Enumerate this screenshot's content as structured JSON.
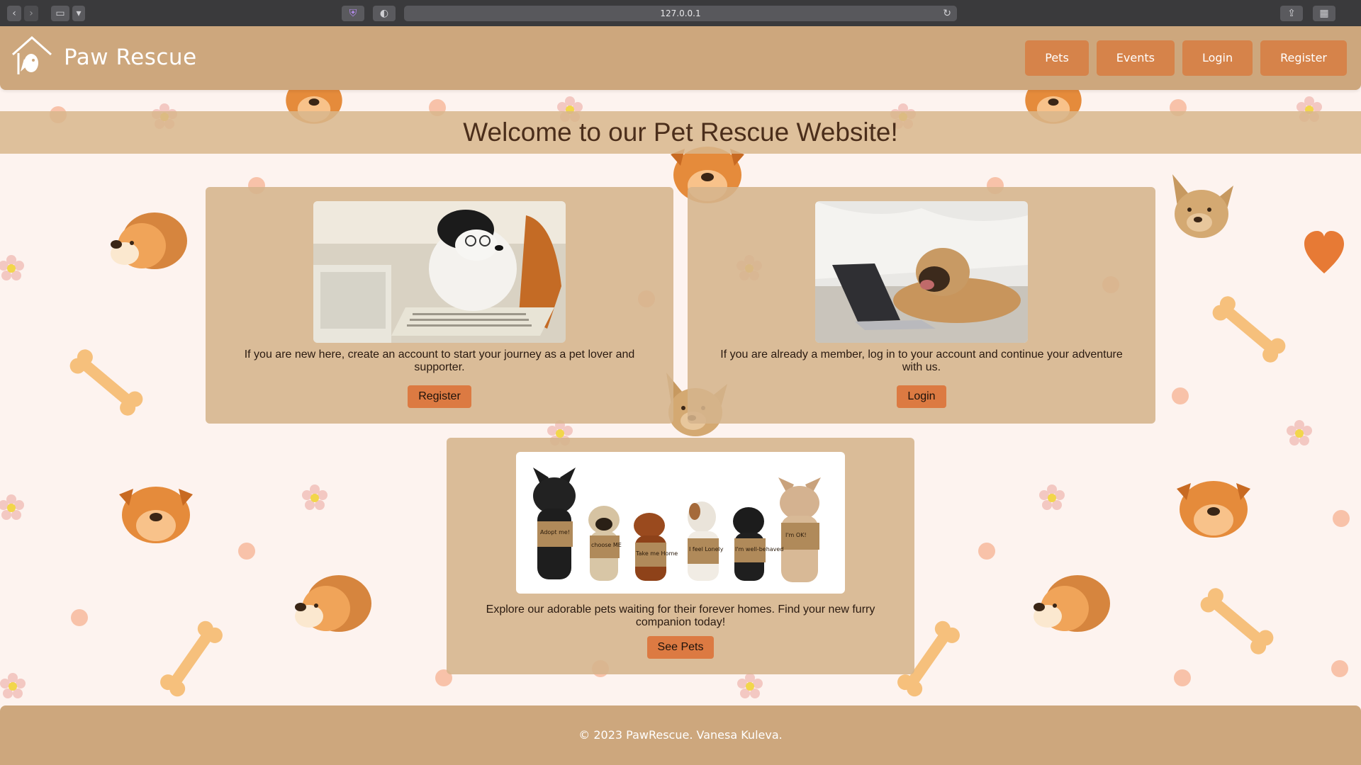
{
  "browser": {
    "url": "127.0.0.1"
  },
  "header": {
    "brand": "Paw Rescue",
    "nav": [
      "Pets",
      "Events",
      "Login",
      "Register"
    ]
  },
  "welcome": {
    "title": "Welcome to our Pet Rescue Website!"
  },
  "cards": {
    "register": {
      "text": "If you are new here, create an account to start your journey as a pet lover and supporter.",
      "button": "Register"
    },
    "login": {
      "text": "If you are already a member, log in to your account and continue your adventure with us.",
      "button": "Login"
    },
    "pets": {
      "text": "Explore our adorable pets waiting for their forever homes. Find your new furry companion today!",
      "button": "See Pets",
      "signs": [
        "Adopt me!",
        "choose ME",
        "Take me Home",
        "I feel Lonely",
        "I'm well-behaved",
        "I'm OK!"
      ]
    }
  },
  "footer": {
    "text": "© 2023 PawRescue. Vanesa Kuleva."
  },
  "colors": {
    "header": "#cda77d",
    "button": "#d6834a",
    "card": "#d5b48c",
    "background": "#fdf3ef"
  }
}
